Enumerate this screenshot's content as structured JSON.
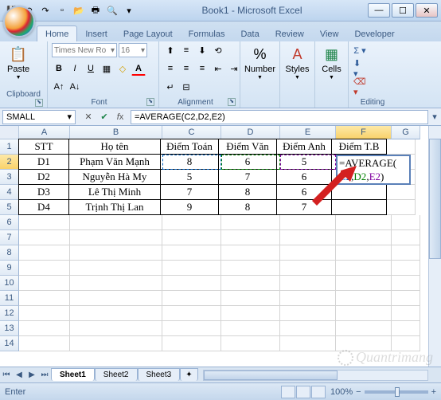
{
  "window": {
    "title": "Book1 - Microsoft Excel"
  },
  "qat_icons": [
    "save-icon",
    "undo-icon",
    "redo-icon",
    "new-icon",
    "open-icon",
    "quickprint-icon",
    "preview-icon"
  ],
  "tabs": [
    "Home",
    "Insert",
    "Page Layout",
    "Formulas",
    "Data",
    "Review",
    "View",
    "Developer"
  ],
  "active_tab": 0,
  "ribbon": {
    "clipboard": {
      "label": "Clipboard",
      "paste": "Paste"
    },
    "font": {
      "label": "Font",
      "family": "Times New Ro",
      "size": "16"
    },
    "alignment": {
      "label": "Alignment"
    },
    "number": {
      "label": "Number",
      "btn": "Number"
    },
    "styles": {
      "label": "Styles",
      "btn": "Styles"
    },
    "cells": {
      "label": "Cells",
      "btn": "Cells"
    },
    "editing": {
      "label": "Editing"
    }
  },
  "namebox": "SMALL",
  "formula": "=AVERAGE(C2,D2,E2)",
  "columns": [
    "A",
    "B",
    "C",
    "D",
    "E",
    "F",
    "G"
  ],
  "rows": [
    "1",
    "2",
    "3",
    "4",
    "5",
    "6",
    "7",
    "8",
    "9",
    "10",
    "11",
    "12",
    "13",
    "14"
  ],
  "active_col": 5,
  "active_row": 1,
  "headers": {
    "a": "STT",
    "b": "Họ tên",
    "c": "Điểm Toán",
    "d": "Điểm Văn",
    "e": "Điểm Anh",
    "f": "Điểm T.B"
  },
  "data_rows": [
    {
      "a": "D1",
      "b": "Phạm Văn Mạnh",
      "c": "8",
      "d": "6",
      "e": "5"
    },
    {
      "a": "D2",
      "b": "Nguyễn Hà My",
      "c": "5",
      "d": "7",
      "e": "6"
    },
    {
      "a": "D3",
      "b": "Lê Thị Minh",
      "c": "7",
      "d": "8",
      "e": "6"
    },
    {
      "a": "D4",
      "b": "Trịnh Thị Lan",
      "c": "9",
      "d": "8",
      "e": "7"
    }
  ],
  "edit_formula": {
    "prefix": "=AVERAGE(",
    "r1": "C2",
    "r2": "D2",
    "r3": "E2",
    "suffix": ")"
  },
  "sheets": [
    "Sheet1",
    "Sheet2",
    "Sheet3"
  ],
  "active_sheet": 0,
  "status": {
    "mode": "Enter",
    "zoom": "100%"
  },
  "watermark": "Quantrimang"
}
